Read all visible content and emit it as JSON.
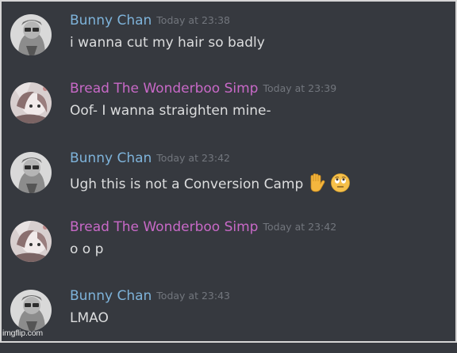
{
  "colors": {
    "background": "#36393f",
    "bunny_name": "#7eb3da",
    "bread_name": "#c869c7",
    "message_text": "#dcddde",
    "timestamp": "#72767d"
  },
  "messages": [
    {
      "author": "Bunny Chan",
      "timestamp": "Today at 23:38",
      "text": "i wanna cut my hair so badly",
      "avatar_icon": "bunny-chan-avatar"
    },
    {
      "author": "Bread The Wonderboo Simp",
      "timestamp": "Today at 23:39",
      "text": "Oof- I wanna straighten mine-",
      "avatar_icon": "bread-avatar"
    },
    {
      "author": "Bunny Chan",
      "timestamp": "Today at 23:42",
      "text": "Ugh this is not a Conversion Camp",
      "emojis": [
        "raised-hand-emoji",
        "eye-roll-emoji"
      ],
      "avatar_icon": "bunny-chan-avatar"
    },
    {
      "author": "Bread The Wonderboo Simp",
      "timestamp": "Today at 23:42",
      "text": "o o p",
      "avatar_icon": "bread-avatar"
    },
    {
      "author": "Bunny Chan",
      "timestamp": "Today at 23:43",
      "text": "LMAO",
      "avatar_icon": "bunny-chan-avatar"
    }
  ],
  "watermark": "imgflip.com"
}
